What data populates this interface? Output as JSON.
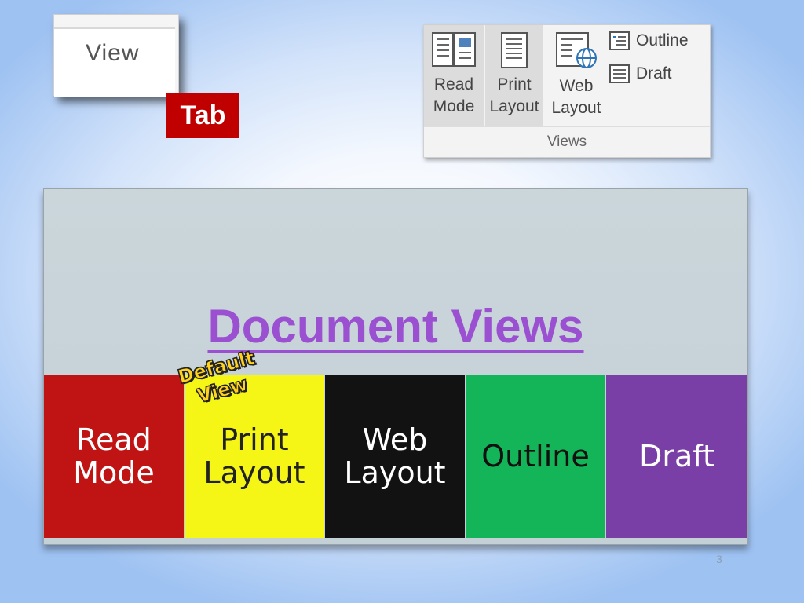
{
  "view_tab": {
    "label": "View"
  },
  "tab_callout": {
    "label": "Tab"
  },
  "ribbon": {
    "buttons": [
      {
        "line1": "Read",
        "line2": "Mode",
        "icon": "book-icon"
      },
      {
        "line1": "Print",
        "line2": "Layout",
        "icon": "page-icon"
      },
      {
        "line1": "Web",
        "line2": "Layout",
        "icon": "web-page-icon"
      }
    ],
    "small_buttons": [
      {
        "label": "Outline",
        "icon": "outline-icon"
      },
      {
        "label": "Draft",
        "icon": "draft-icon"
      }
    ],
    "group_label": "Views"
  },
  "panel": {
    "title": "Document Views",
    "cells": [
      {
        "line1": "Read",
        "line2": "Mode",
        "bg": "#c01414",
        "fg": "#ffffff"
      },
      {
        "line1": "Print",
        "line2": "Layout",
        "bg": "#f5f516",
        "fg": "#222222"
      },
      {
        "line1": "Web",
        "line2": "Layout",
        "bg": "#121212",
        "fg": "#ffffff"
      },
      {
        "line1": "Outline",
        "line2": "",
        "bg": "#14b458",
        "fg": "#111111"
      },
      {
        "line1": "Draft",
        "line2": "",
        "bg": "#7a3fa6",
        "fg": "#ffffff"
      }
    ],
    "default_view": {
      "line1": "Default",
      "line2": "View"
    }
  },
  "page_number": "3",
  "colors": {
    "title": "#9b4fd1",
    "tab_callout": "#c00000"
  }
}
